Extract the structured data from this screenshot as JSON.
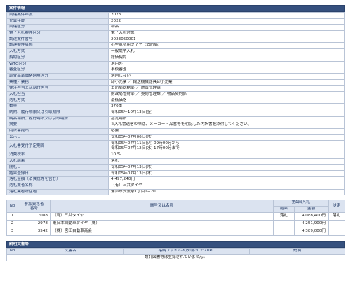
{
  "case_info": {
    "title": "案件情報",
    "rows": [
      {
        "label": "調達案件年度",
        "value": "2023"
      },
      {
        "label": "化算年度",
        "value": "2022"
      },
      {
        "label": "調達区分",
        "value": "物品"
      },
      {
        "label": "電子入札案件区分",
        "value": "電子入札対象"
      },
      {
        "label": "調達案件番号",
        "value": "2023050001"
      },
      {
        "label": "調達案件名称",
        "value": "小型車冬用タイヤ（消防局）"
      },
      {
        "label": "入札方式",
        "value": "一般競争入札"
      },
      {
        "label": "契約区分",
        "value": "総価契約"
      },
      {
        "label": "WTO区分",
        "value": "適用外"
      },
      {
        "label": "審査区分",
        "value": "事後審査"
      },
      {
        "label": "調査基準価格適用区分",
        "value": "適用しない"
      },
      {
        "label": "業種／業務",
        "value": "卸小売業 ／ 輸送機械器具卸小売業"
      },
      {
        "label": "発注担当又は執行担当",
        "value": "消防局総務部 ／ 施設管理課"
      },
      {
        "label": "入札担当",
        "value": "財政局管財部 ／ 契約管理課 ／ 物品契約係"
      },
      {
        "label": "落札方式",
        "value": "最低価格"
      },
      {
        "label": "数量",
        "value": "370本"
      },
      {
        "label": "納期、履行期限又は引取期限",
        "value": "令和05年10月13日(金)"
      },
      {
        "label": "納品場所、履行場所又は引取場所",
        "value": "指定場所"
      },
      {
        "label": "摘要",
        "value": "※入札書送信の際は、メーカー・品番等を明記した内訳書を添付してください。"
      },
      {
        "label": "内訳書提出",
        "value": "必要"
      },
      {
        "label": "公示日",
        "value": "令和05年07月06日(木)"
      },
      {
        "label": "入札書受付予定期間",
        "value": "令和05年07月11日(火) 09時00分から\n令和05年07月12日(水) 17時00分まで"
      },
      {
        "label": "消費税率",
        "value": "10 %"
      },
      {
        "label": "入札結果",
        "value": "落札"
      },
      {
        "label": "開札日",
        "value": "令和05年07月13日(木)"
      },
      {
        "label": "結果登録日",
        "value": "令和05年07月13日(木)"
      },
      {
        "label": "落札金額（消費税等を含む）",
        "value": "4,497,240円"
      },
      {
        "label": "落札業者名称",
        "value": "（有）三共タイヤ"
      },
      {
        "label": "落札業者所在地",
        "value": "浦添市安波茶1丁目1−20"
      }
    ]
  },
  "results": {
    "headers": {
      "no": "No",
      "bidder_no": "参加資格者\n番号",
      "name": "商号又は名称",
      "round": "第1回入札",
      "result": "結果",
      "amount": "金額",
      "decision": "決定"
    },
    "rows": [
      {
        "no": "1",
        "bidder_no": "7088",
        "name": "（有）三共タイヤ",
        "result": "落札",
        "amount": "4,088,400円",
        "decision": "落札"
      },
      {
        "no": "2",
        "bidder_no": "2978",
        "name": "東日本自動車タイヤ（株）",
        "result": "",
        "amount": "4,251,900円",
        "decision": ""
      },
      {
        "no": "3",
        "bidder_no": "3542",
        "name": "（株）宮田自動車商会",
        "result": "",
        "amount": "4,389,000円",
        "decision": ""
      }
    ]
  },
  "documents": {
    "title": "説明文書等",
    "headers": {
      "no": "No",
      "doc_name": "文書名",
      "file": "格納ファイル名/外部リンクURL",
      "desc": "説明"
    },
    "empty_message": "設計図書等は登録されていません。"
  }
}
